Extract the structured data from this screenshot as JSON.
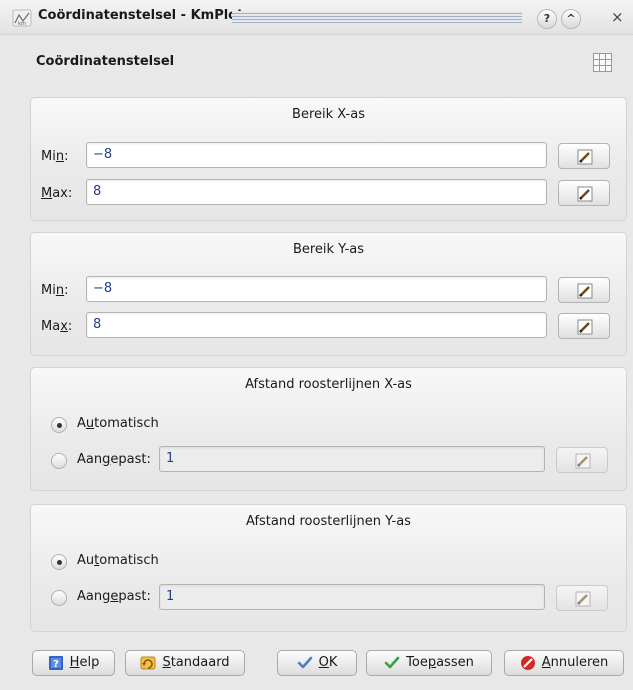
{
  "window": {
    "title": "Coördinatenstelsel - KmPlot",
    "app_icon_text": "km",
    "help_glyph": "?",
    "shade_glyph": "^",
    "close_glyph": "×"
  },
  "page": {
    "heading": "Coördinatenstelsel"
  },
  "x_range": {
    "title": "Bereik X-as",
    "min": {
      "label_pre": "Mi",
      "label_u": "n",
      "label_post": ":",
      "value": "−8"
    },
    "max": {
      "label_pre": "",
      "label_u": "M",
      "label_post": "ax:",
      "value": "8"
    }
  },
  "y_range": {
    "title": "Bereik Y-as",
    "min": {
      "label_pre": "Mi",
      "label_u": "n",
      "label_post": ":",
      "value": "−8"
    },
    "max": {
      "label_pre": "Ma",
      "label_u": "x",
      "label_post": ":",
      "value": "8"
    }
  },
  "x_grid": {
    "title": "Afstand roosterlijnen X-as",
    "automatic": {
      "pre": "A",
      "u": "u",
      "post": "tomatisch",
      "selected": true
    },
    "custom": {
      "pre": "Aan",
      "u": "g",
      "post": "epast:",
      "selected": false,
      "value": "1"
    }
  },
  "y_grid": {
    "title": "Afstand roosterlijnen Y-as",
    "automatic": {
      "pre": "Au",
      "u": "t",
      "post": "omatisch",
      "selected": true
    },
    "custom": {
      "pre": "Aang",
      "u": "e",
      "post": "past:",
      "selected": false,
      "value": "1"
    }
  },
  "buttons": {
    "help": {
      "pre": "",
      "u": "H",
      "post": "elp"
    },
    "defaults": {
      "pre": "",
      "u": "S",
      "post": "tandaard"
    },
    "ok": {
      "pre": "",
      "u": "O",
      "post": "K"
    },
    "apply": {
      "pre": "Toe",
      "u": "p",
      "post": "assen"
    },
    "cancel": {
      "pre": "",
      "u": "A",
      "post": "nnuleren"
    }
  },
  "colors": {
    "value_text": "#243f86",
    "help_icon": "#2f64c8",
    "ok_check": "#4a80c4",
    "apply_check": "#3aa043",
    "cancel_icon": "#d42828"
  },
  "icons": [
    "window-app-icon",
    "help-icon",
    "shade-icon",
    "close-icon",
    "grid-icon",
    "pencil-icon",
    "help-book-icon",
    "reset-icon",
    "checkmark-icon",
    "cancel-icon"
  ]
}
